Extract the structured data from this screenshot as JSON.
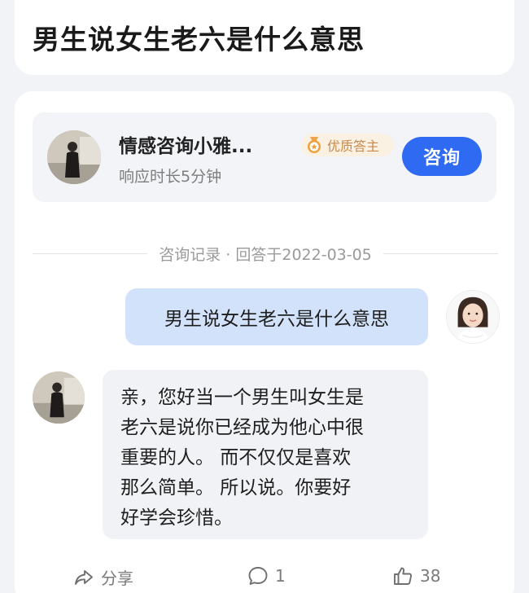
{
  "page": {
    "title": "男生说女生老六是什么意思"
  },
  "expert": {
    "name": "情感咨询小雅...",
    "badge": "优质答主",
    "response_time": "响应时长5分钟",
    "consult_button": "咨询"
  },
  "record": {
    "divider_text": "咨询记录 · 回答于2022-03-05"
  },
  "conversation": {
    "question": "男生说女生老六是什么意思",
    "answer_lines": [
      "亲，您好当一个男生叫女生是",
      "老六是说你已经成为他心中很",
      "重要的人。 而不仅仅是喜欢",
      "那么简单。 所以说。你要好",
      "好学会珍惜。"
    ]
  },
  "footer": {
    "share_label": "分享",
    "comment_count": "1",
    "like_count": "38"
  },
  "colors": {
    "accent": "#2f6bf2",
    "question_bubble": "#d3e2fb",
    "badge_text": "#c8894a",
    "background": "#f2f3f6"
  },
  "icons": {
    "share": "share-icon",
    "comment": "comment-icon",
    "like": "thumbs-up-icon",
    "badge": "medal-icon"
  }
}
